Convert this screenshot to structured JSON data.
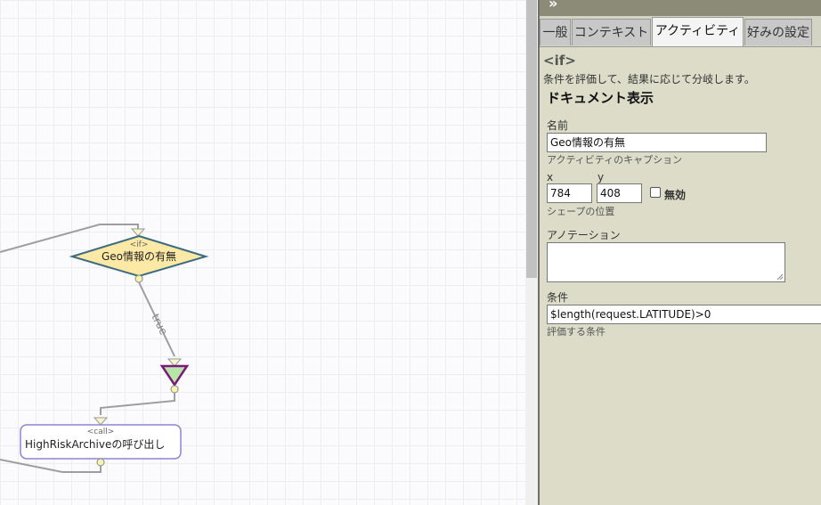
{
  "canvas": {
    "if_node": {
      "tag": "<if>",
      "label": "Geo情報の有無"
    },
    "edge_label": "true",
    "call_node": {
      "tag": "<call>",
      "label": "HighRiskArchiveの呼び出し"
    }
  },
  "panel": {
    "tabs": [
      {
        "label": "一般"
      },
      {
        "label": "コンテキスト"
      },
      {
        "label": "アクティビティ"
      },
      {
        "label": "好みの設定"
      }
    ],
    "activity_type": "<if>",
    "activity_description": "条件を評価して、結果に応じて分岐します。",
    "doc_link": "ドキュメント表示",
    "name": {
      "label": "名前",
      "value": "Geo情報の有無",
      "hint": "アクティビティのキャプション"
    },
    "position": {
      "x_label": "x",
      "x_value": "784",
      "y_label": "y",
      "y_value": "408",
      "hint": "シェープの位置"
    },
    "disabled_label": "無効",
    "annotation_label": "アノテーション",
    "condition": {
      "label": "条件",
      "value": "$length(request.LATITUDE)>0",
      "hint": "評価する条件"
    }
  },
  "colors": {
    "if_fill": "#fde9a6",
    "if_stroke": "#3d6b80",
    "merge_fill": "#b8e6a8",
    "merge_stroke": "#7a1a7a",
    "call_stroke": "#8b86d6",
    "panel_bg": "#dcdcc9"
  }
}
